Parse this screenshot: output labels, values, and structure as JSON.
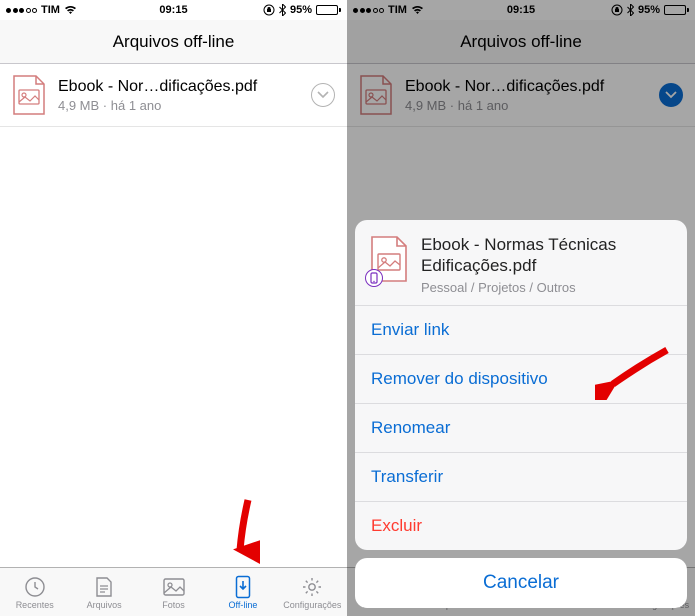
{
  "status_bar": {
    "carrier": "TIM",
    "time": "09:15",
    "battery_pct": "95%"
  },
  "header": {
    "title": "Arquivos off-line"
  },
  "file": {
    "name_short": "Ebook - Nor…dificações.pdf",
    "name_full_line1": "Ebook - Normas Técnicas",
    "name_full_line2": "Edificações.pdf",
    "size": "4,9 MB",
    "sep": " · ",
    "age": "há 1 ano",
    "path": "Pessoal / Projetos / Outros"
  },
  "sheet": {
    "send_link": "Enviar link",
    "remove_device": "Remover do dispositivo",
    "rename": "Renomear",
    "transfer": "Transferir",
    "delete": "Excluir",
    "cancel": "Cancelar"
  },
  "tabs": {
    "recent": "Recentes",
    "files": "Arquivos",
    "photos": "Fotos",
    "offline": "Off-line",
    "settings": "Configurações"
  }
}
